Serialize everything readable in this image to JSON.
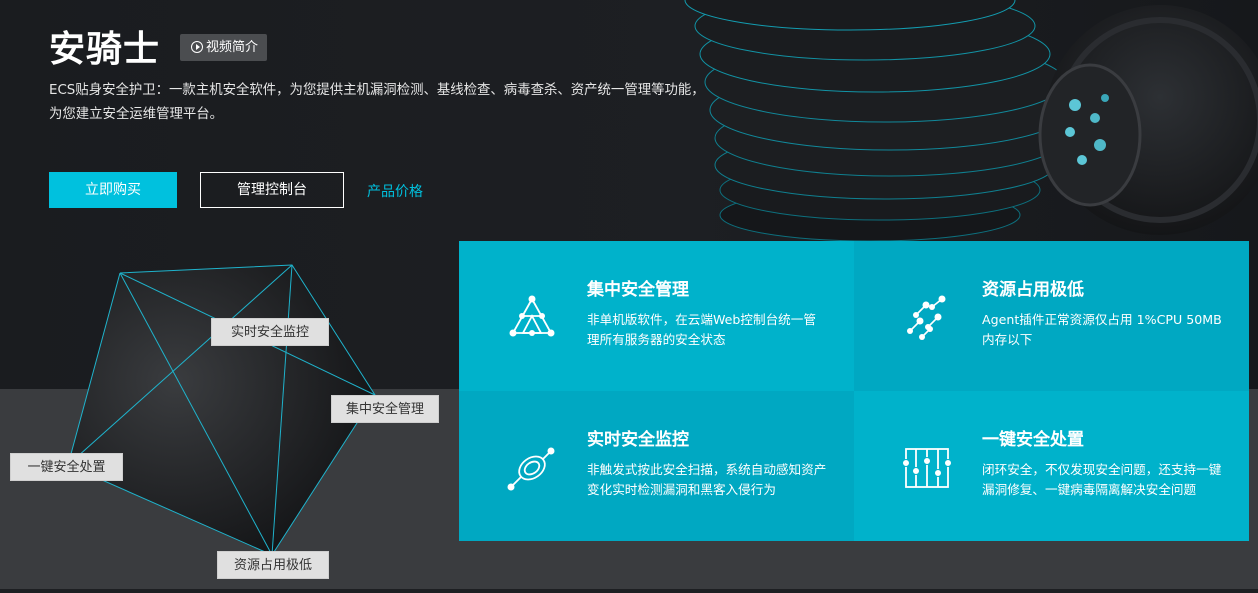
{
  "product": {
    "title": "安骑士",
    "video_label": "视频简介",
    "description": "ECS贴身安全护卫：一款主机安全软件，为您提供主机漏洞检测、基线检查、病毒查杀、资产统一管理等功能，为您建立安全运维管理平台。"
  },
  "actions": {
    "buy_label": "立即购买",
    "console_label": "管理控制台",
    "price_label": "产品价格"
  },
  "diagram": {
    "labels": [
      "实时安全监控",
      "集中安全管理",
      "一键安全处置",
      "资源占用极低"
    ]
  },
  "features": [
    {
      "icon": "network-triangle-icon",
      "title": "集中安全管理",
      "desc": "非单机版软件，在云端Web控制台统一管理所有服务器的安全状态"
    },
    {
      "icon": "nodes-scatter-icon",
      "title": "资源占用极低",
      "desc": "Agent插件正常资源仅占用 1%CPU 50MB内存以下"
    },
    {
      "icon": "monitor-disc-icon",
      "title": "实时安全监控",
      "desc": "非触发式按此安全扫描，系统自动感知资产变化实时检测漏洞和黑客入侵行为"
    },
    {
      "icon": "sliders-panel-icon",
      "title": "一键安全处置",
      "desc": "闭环安全，不仅发现安全问题，还支持一键漏洞修复、一键病毒隔离解决安全问题"
    }
  ],
  "colors": {
    "accent": "#00c1de",
    "feature_a": "#00b2cb",
    "feature_b": "#00a8c2",
    "background": "#1d1f22",
    "band": "#3a3c3f"
  }
}
